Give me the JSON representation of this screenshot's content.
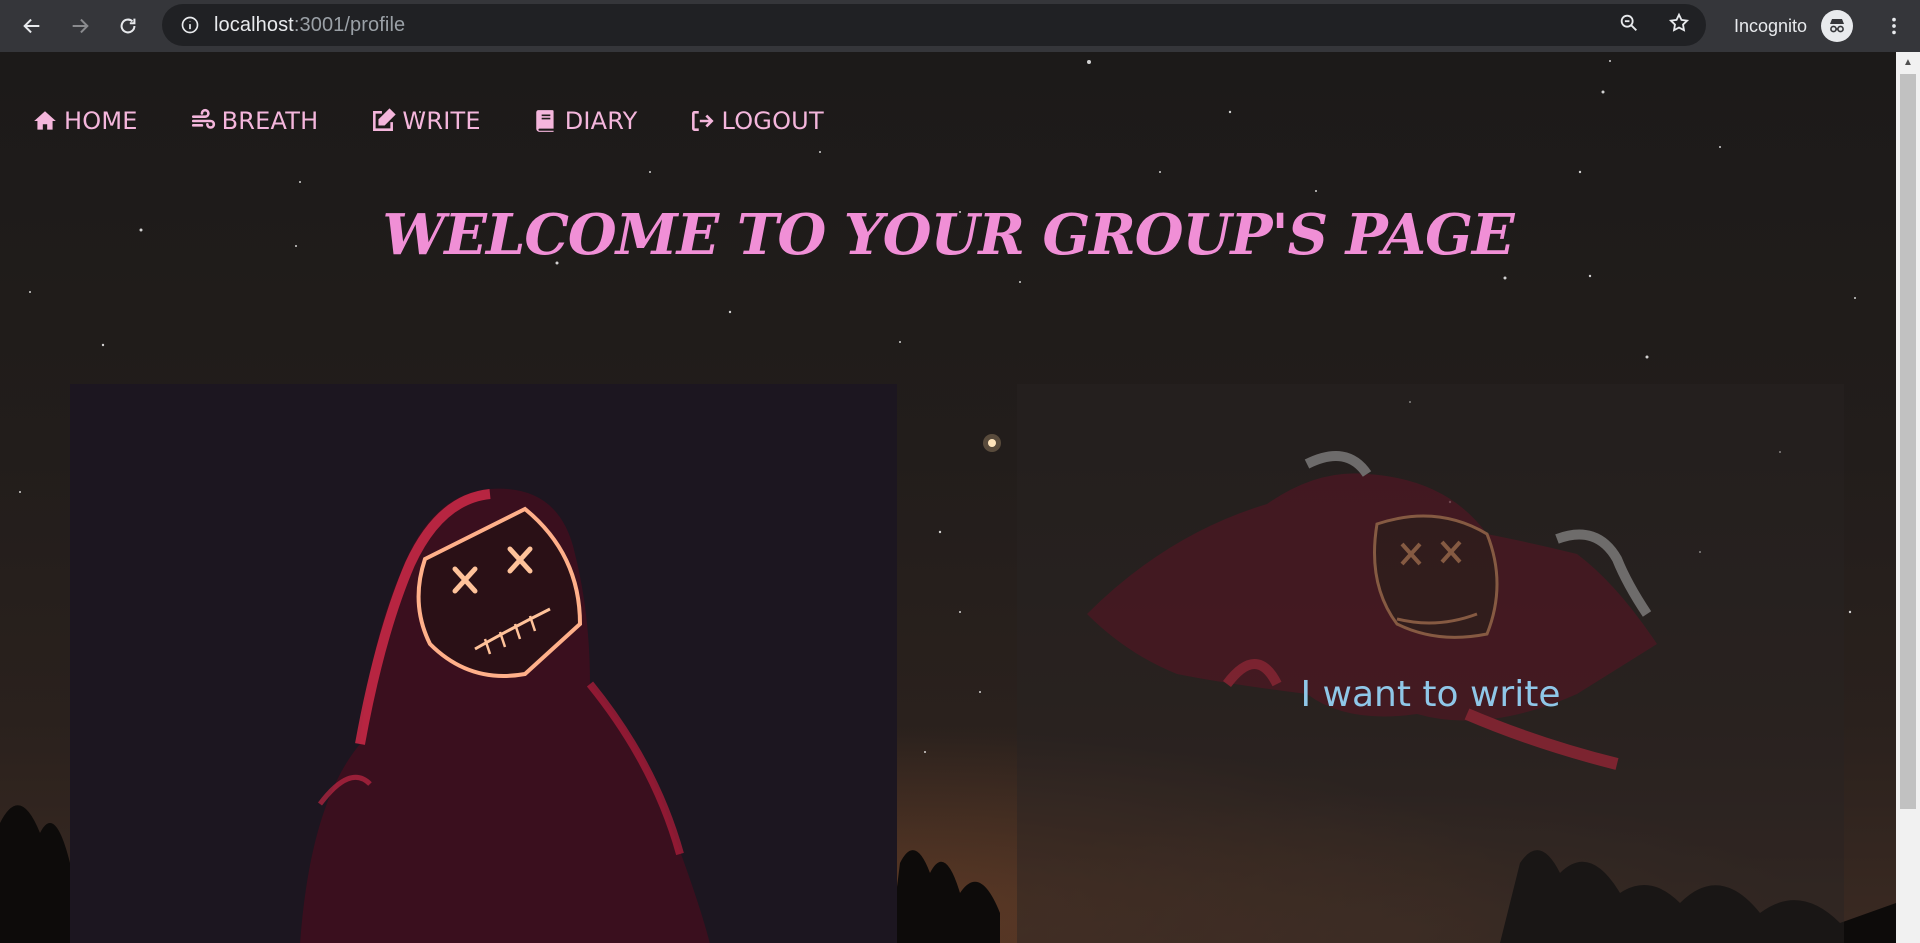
{
  "browser": {
    "url_host": "localhost",
    "url_path": ":3001/profile",
    "mode_label": "Incognito"
  },
  "nav": {
    "items": [
      {
        "label": "HOME",
        "icon": "home-icon"
      },
      {
        "label": "BREATH",
        "icon": "wind-icon"
      },
      {
        "label": "WRITE",
        "icon": "edit-icon"
      },
      {
        "label": "DIARY",
        "icon": "book-icon"
      },
      {
        "label": "LOGOUT",
        "icon": "logout-icon"
      }
    ]
  },
  "main": {
    "title": "WELCOME TO YOUR GROUP'S PAGE",
    "right_card_text": "I want to write"
  },
  "colors": {
    "nav_text": "#f4b6dc",
    "title": "#f08fd6",
    "card_text": "#8fc7e8",
    "mask_neon": "#ff3a5a"
  }
}
